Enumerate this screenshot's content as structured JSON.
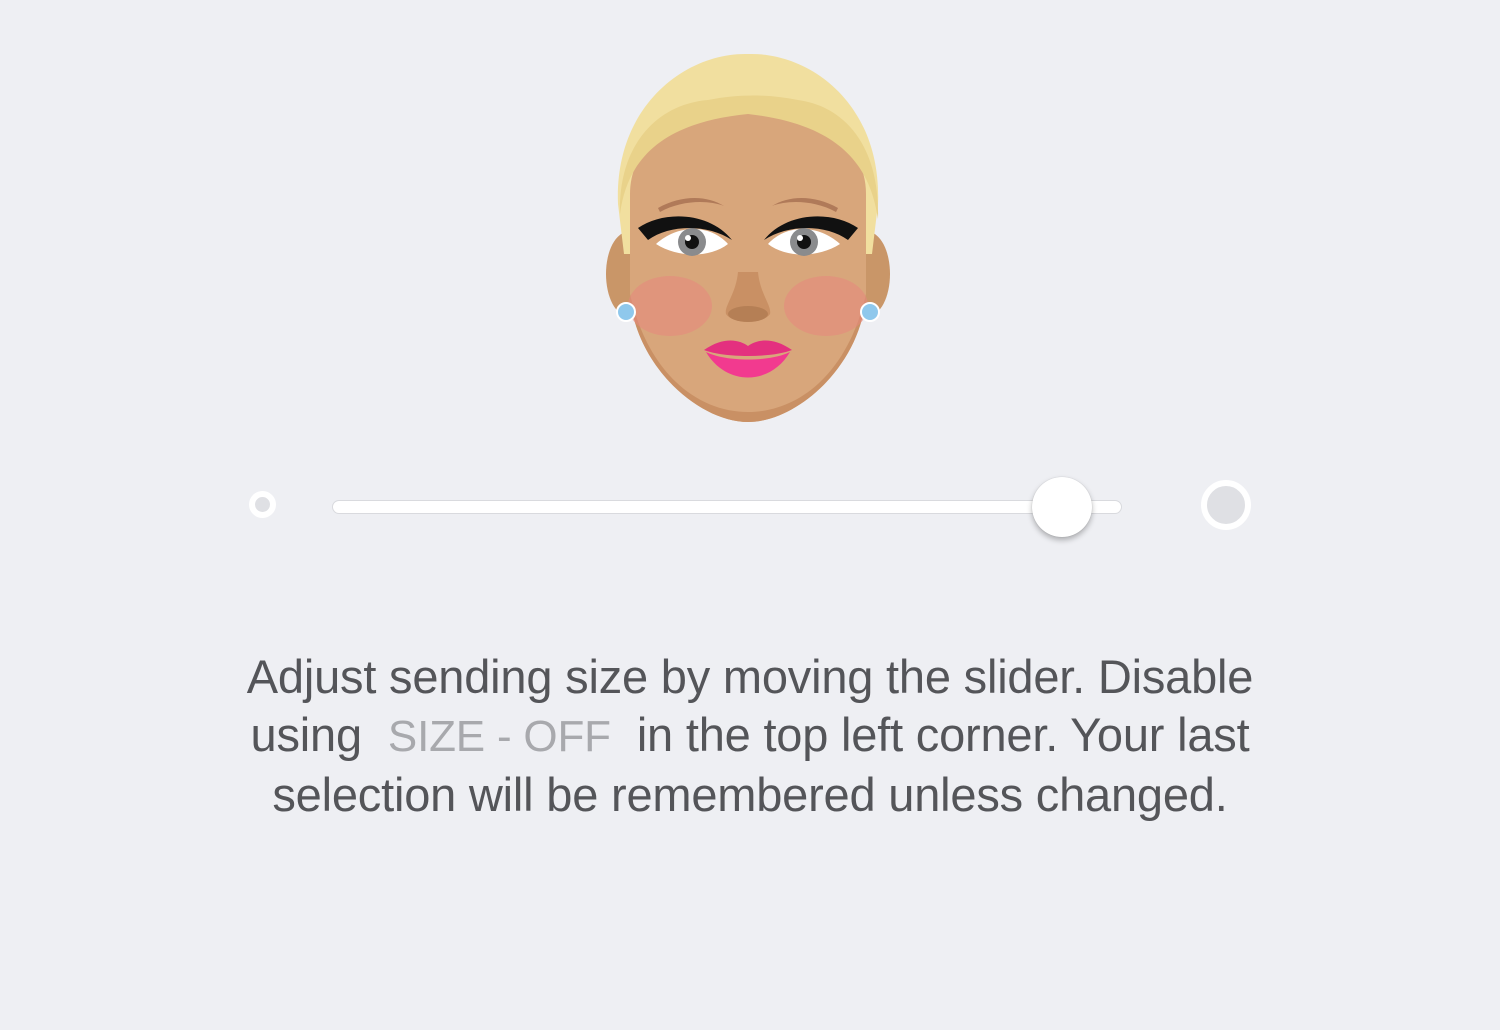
{
  "preview": {
    "icon": "face-emoji-icon",
    "colors": {
      "hair": "#f1df9f",
      "skin": "#d8a67b",
      "lips": "#f23a8f",
      "blush": "#e8867e",
      "earring": "#8fc8ec"
    }
  },
  "slider": {
    "min_icon": "small-circle-icon",
    "max_icon": "large-circle-icon",
    "value": 0.96
  },
  "instructions": {
    "line1": "Adjust sending size by moving the slider. Disable",
    "line2_before": "using",
    "button_label": "SIZE - OFF",
    "line2_after": "in the top left corner. Your last",
    "line3": "selection will be remembered unless changed."
  }
}
